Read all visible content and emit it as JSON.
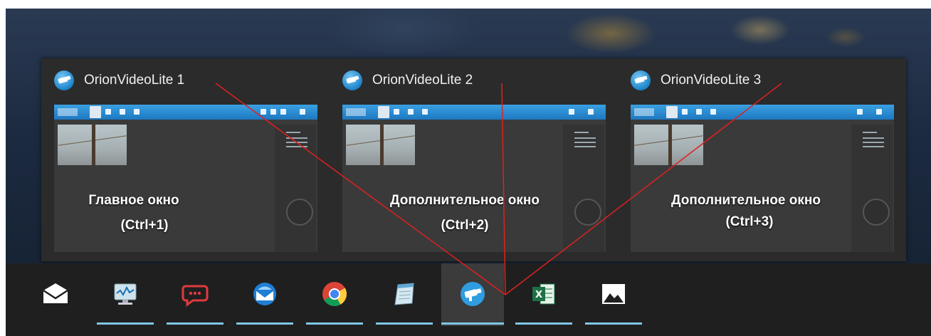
{
  "colors": {
    "panel_bg": "#2b2b2b",
    "taskbar_bg": "#1f1f1f",
    "accent_underline": "#7fc7e8",
    "annotation_line": "#e02020",
    "mini_toolbar": "#1d78c0"
  },
  "preview": {
    "thumbnails": [
      {
        "title": "OrionVideoLite 1",
        "caption_line1": "Главное окно",
        "caption_line2": "(Ctrl+1)",
        "icon": "camera-app-icon"
      },
      {
        "title": "OrionVideoLite 2",
        "caption_line1": "Дополнительное окно",
        "caption_line2": "(Ctrl+2)",
        "icon": "camera-app-icon"
      },
      {
        "title": "OrionVideoLite 3",
        "caption_line1": "Дополнительное окно",
        "caption_line2": "(Ctrl+3)",
        "icon": "camera-app-icon"
      }
    ]
  },
  "taskbar": {
    "items": [
      {
        "icon": "mail-envelope-icon",
        "running": false,
        "active": false
      },
      {
        "icon": "system-monitor-icon",
        "running": true,
        "active": false
      },
      {
        "icon": "chat-bubble-icon",
        "running": true,
        "active": false
      },
      {
        "icon": "mail-client-icon",
        "running": true,
        "active": false
      },
      {
        "icon": "chrome-browser-icon",
        "running": true,
        "active": false
      },
      {
        "icon": "notepad-icon",
        "running": true,
        "active": false
      },
      {
        "icon": "camera-app-icon",
        "running": true,
        "active": true
      },
      {
        "icon": "excel-icon",
        "running": true,
        "active": false
      },
      {
        "icon": "photos-icon",
        "running": true,
        "active": false
      }
    ]
  }
}
